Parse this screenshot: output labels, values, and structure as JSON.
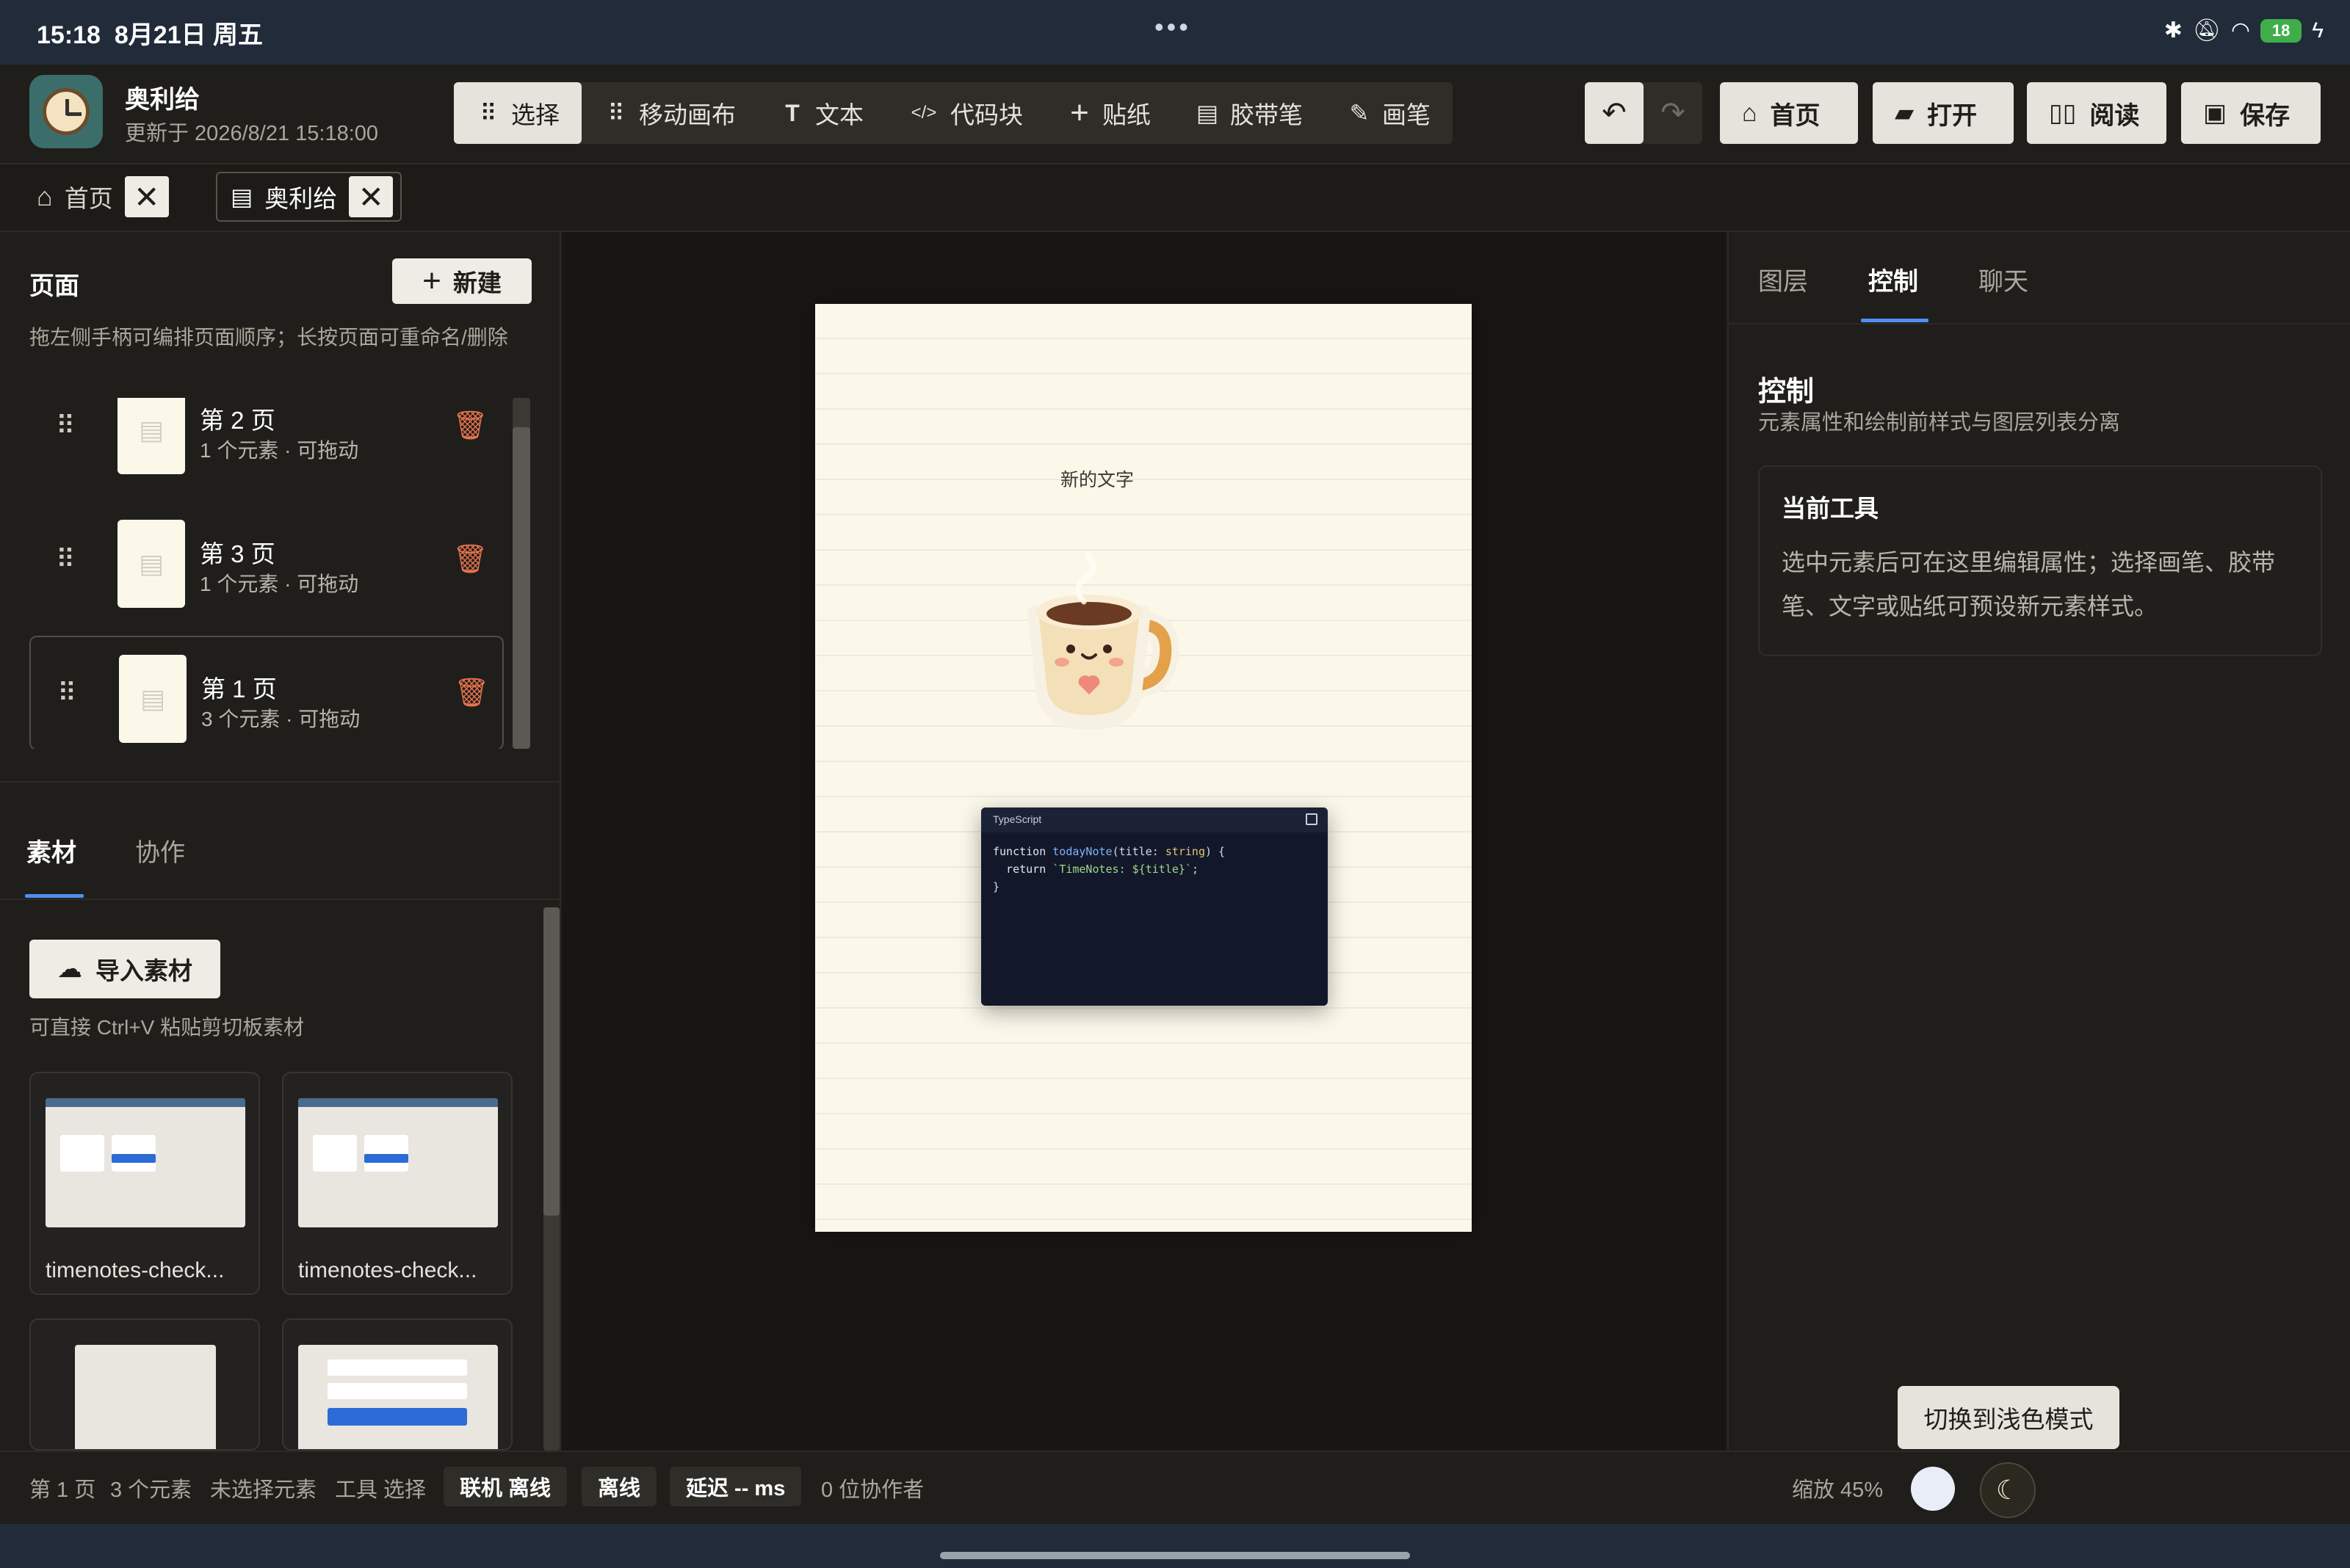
{
  "status_bar": {
    "time": "15:18",
    "date": "8月21日 周五",
    "battery": "18"
  },
  "app": {
    "doc_title": "奥利给",
    "updated": "更新于 2026/8/21 15:18:00"
  },
  "toolbar": {
    "tools": [
      {
        "label": "选择",
        "icon": "grip-icon",
        "glyph": "⠿",
        "active": true
      },
      {
        "label": "移动画布",
        "icon": "grip-icon",
        "glyph": "⠿"
      },
      {
        "label": "文本",
        "icon": "text-icon",
        "glyph": "T"
      },
      {
        "label": "代码块",
        "icon": "code-icon",
        "glyph": "</>"
      },
      {
        "label": "贴纸",
        "icon": "plus-icon",
        "glyph": "+"
      },
      {
        "label": "胶带笔",
        "icon": "document-icon",
        "glyph": "▤"
      },
      {
        "label": "画笔",
        "icon": "edit-icon",
        "glyph": "✎"
      }
    ],
    "home": "首页",
    "open": "打开",
    "read": "阅读",
    "save": "保存"
  },
  "doc_tabs": [
    {
      "label": "首页",
      "icon": "home-icon"
    },
    {
      "label": "奥利给",
      "icon": "document-icon"
    }
  ],
  "left_panel": {
    "title": "页面",
    "new_label": "新建",
    "hint": "拖左侧手柄可编排页面顺序；长按页面可重命名/删除",
    "pages": [
      {
        "name": "第 2 页",
        "meta": "1 个元素 · 可拖动"
      },
      {
        "name": "第 3 页",
        "meta": "1 个元素 · 可拖动"
      },
      {
        "name": "第 1 页",
        "meta": "3 个元素 · 可拖动",
        "selected": true
      }
    ],
    "subtabs": [
      "素材",
      "协作"
    ],
    "import_label": "导入素材",
    "paste_hint": "可直接 Ctrl+V 粘贴剪切板素材",
    "assets": [
      "timenotes-check...",
      "timenotes-check..."
    ]
  },
  "canvas": {
    "text": "新的文字",
    "code": {
      "lang": "TypeScript",
      "line1_kw": "function",
      "line1_fn": "todayNote",
      "line1_rest": "(title: ",
      "line1_type": "string",
      "line1_end": ") {",
      "line2_kw": "  return",
      "line2_str": "`TimeNotes: ${title}`",
      "line2_end": ";",
      "line3": "}"
    }
  },
  "right_panel": {
    "tabs": [
      "图层",
      "控制",
      "聊天"
    ],
    "title": "控制",
    "subtitle": "元素属性和绘制前样式与图层列表分离",
    "card_title": "当前工具",
    "card_body": "选中元素后可在这里编辑属性；选择画笔、胶带笔、文字或贴纸可预设新元素样式。"
  },
  "bottom_bar": {
    "page": "第 1 页",
    "elements": "3 个元素",
    "selection": "未选择元素",
    "tool": "工具 选择",
    "online": "联机 离线",
    "offline": "离线",
    "latency": "延迟 -- ms",
    "collaborators": "0 位协作者",
    "zoom": "缩放 45%",
    "tooltip": "切换到浅色模式"
  },
  "colors": {
    "accent": "#4f8ff5",
    "danger": "#e8734f",
    "paper": "#fbf8ea",
    "code_bg": "#12182a"
  }
}
